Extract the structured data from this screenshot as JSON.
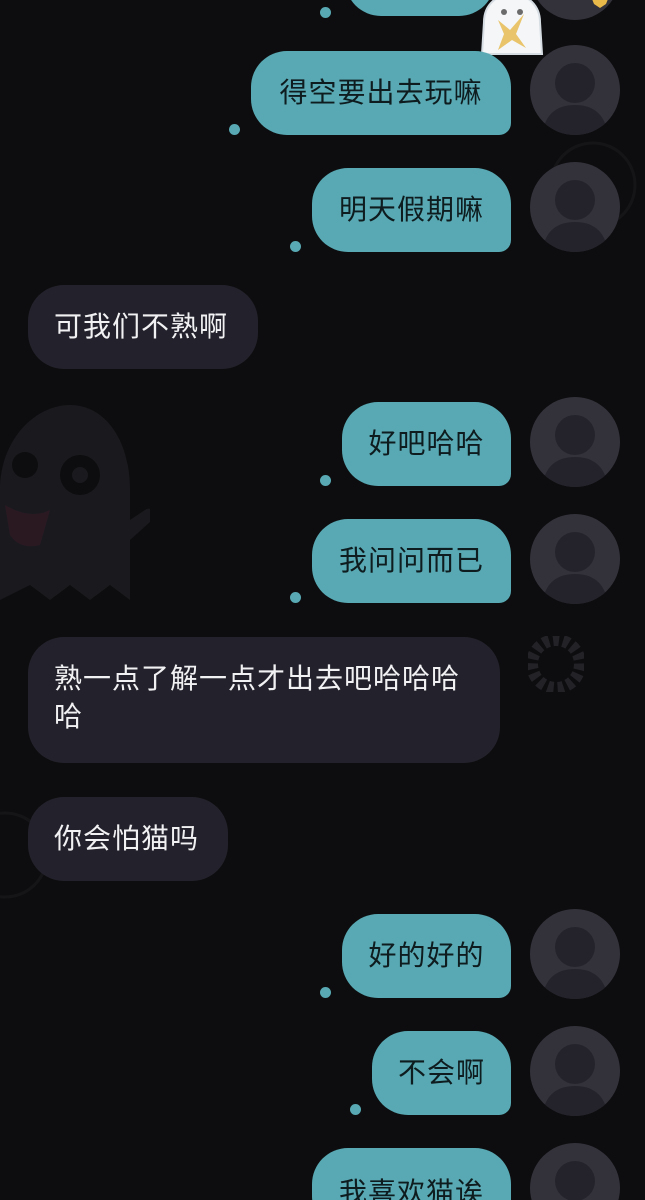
{
  "colors": {
    "background": "#0d0d0f",
    "outgoing_bubble": "#58a9b3",
    "incoming_bubble": "#23222c",
    "avatar": "#33323b"
  },
  "messages": [
    {
      "side": "out",
      "text": "",
      "avatar": "default-avatar-icon",
      "partial": "top"
    },
    {
      "side": "out",
      "text": "得空要出去玩嘛",
      "avatar": "default-avatar-icon"
    },
    {
      "side": "out",
      "text": "明天假期嘛",
      "avatar": "default-avatar-icon"
    },
    {
      "side": "in",
      "text": "可我们不熟啊"
    },
    {
      "side": "out",
      "text": "好吧哈哈",
      "avatar": "default-avatar-icon"
    },
    {
      "side": "out",
      "text": "我问问而已",
      "avatar": "default-avatar-icon"
    },
    {
      "side": "in",
      "text": "熟一点了解一点才出去吧哈哈哈哈"
    },
    {
      "side": "in",
      "text": "你会怕猫吗"
    },
    {
      "side": "out",
      "text": "好的好的",
      "avatar": "default-avatar-icon"
    },
    {
      "side": "out",
      "text": "不会啊",
      "avatar": "default-avatar-icon"
    },
    {
      "side": "out",
      "text": "我喜欢猫诶",
      "avatar": "default-avatar-icon",
      "partial": "bottom"
    }
  ],
  "decorations": [
    "ghost-sticker-icon",
    "ghost-background-icon",
    "donut-background-icon",
    "star-icon"
  ]
}
